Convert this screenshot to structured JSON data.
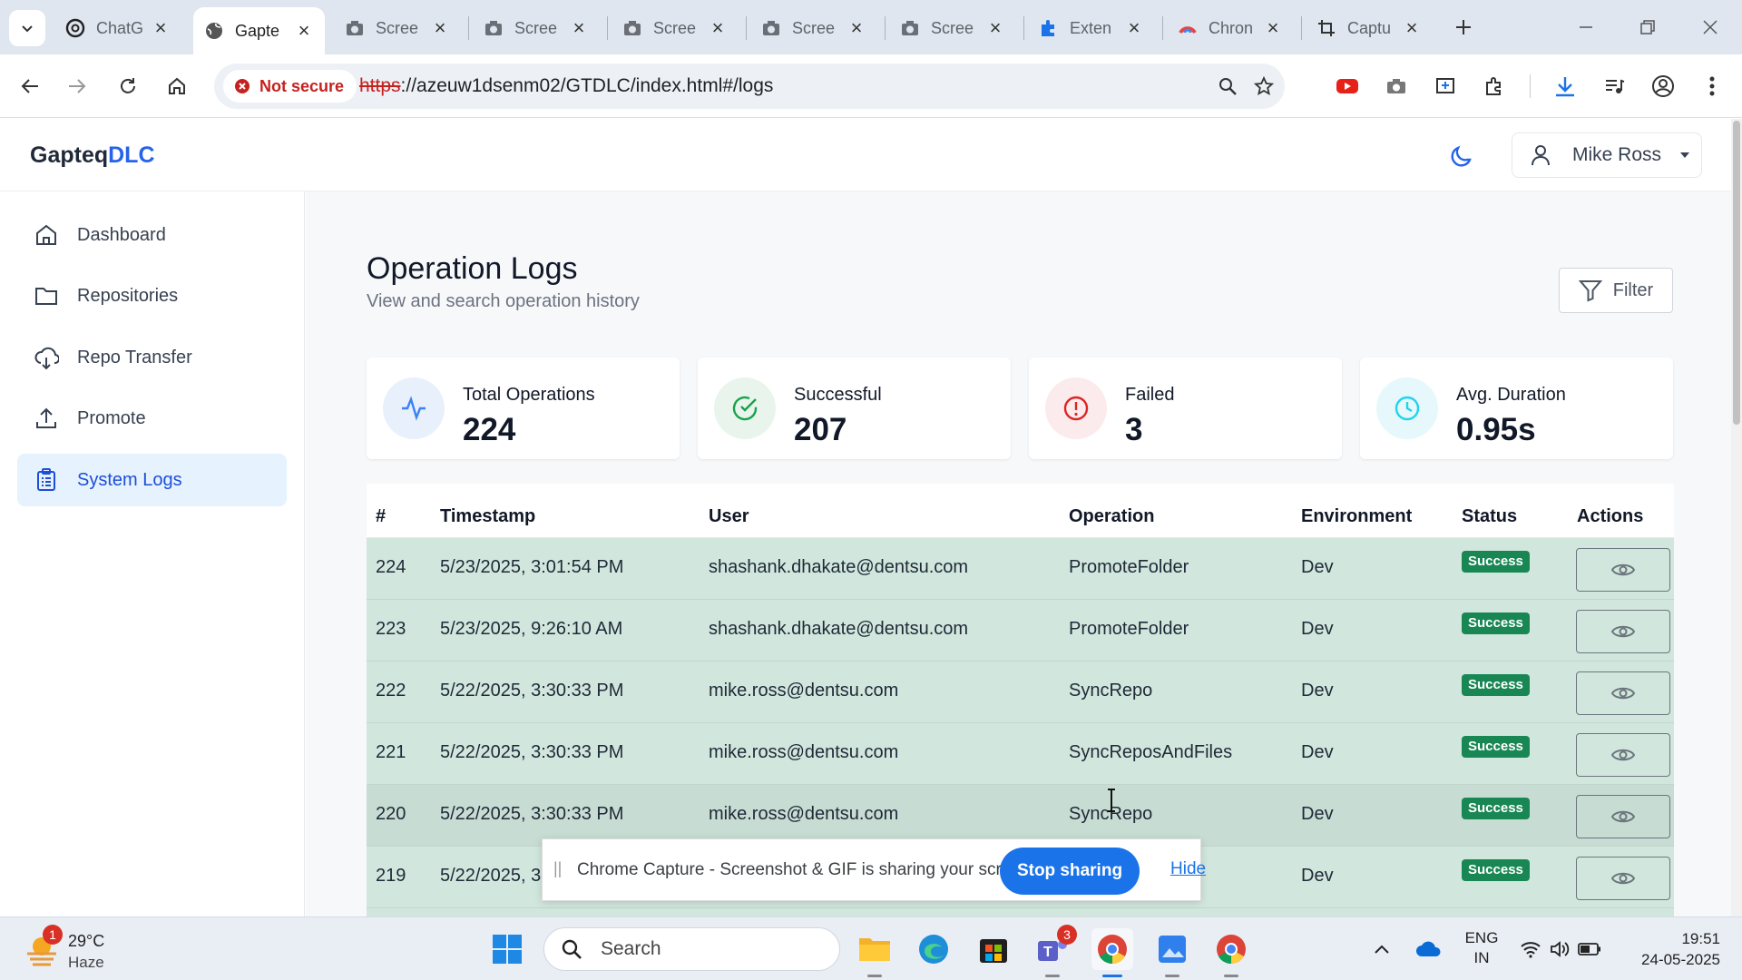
{
  "browser": {
    "tabs": [
      {
        "title": "ChatG",
        "icon": "openai-icon"
      },
      {
        "title": "Gapte",
        "icon": "globe-icon",
        "active": true
      },
      {
        "title": "Scree",
        "icon": "camera-icon"
      },
      {
        "title": "Scree",
        "icon": "camera-icon"
      },
      {
        "title": "Scree",
        "icon": "camera-icon"
      },
      {
        "title": "Scree",
        "icon": "camera-icon"
      },
      {
        "title": "Scree",
        "icon": "camera-icon"
      },
      {
        "title": "Exten",
        "icon": "puzzle-icon"
      },
      {
        "title": "Chron",
        "icon": "chrome-icon"
      },
      {
        "title": "Captu",
        "icon": "capture-icon"
      }
    ],
    "security_label": "Not secure",
    "url_scheme": "https",
    "url_rest": "://azeuw1dsenm02/GTDLC/index.html#/logs"
  },
  "app": {
    "brand_main": "Gapteq",
    "brand_accent": "DLC",
    "user_name": "Mike Ross"
  },
  "sidebar": {
    "items": [
      {
        "label": "Dashboard",
        "icon": "home-icon"
      },
      {
        "label": "Repositories",
        "icon": "folder-icon"
      },
      {
        "label": "Repo Transfer",
        "icon": "cloud-transfer-icon"
      },
      {
        "label": "Promote",
        "icon": "upload-icon"
      },
      {
        "label": "System Logs",
        "icon": "clipboard-icon",
        "active": true
      }
    ]
  },
  "page": {
    "title": "Operation Logs",
    "subtitle": "View and search operation history",
    "filter_label": "Filter"
  },
  "stats": [
    {
      "label": "Total Operations",
      "value": "224",
      "icon": "activity-icon",
      "color": "#3b82f6"
    },
    {
      "label": "Successful",
      "value": "207",
      "icon": "check-circle-icon",
      "color": "#16a34a"
    },
    {
      "label": "Failed",
      "value": "3",
      "icon": "alert-circle-icon",
      "color": "#dc2626"
    },
    {
      "label": "Avg. Duration",
      "value": "0.95s",
      "icon": "clock-icon",
      "color": "#22d3ee"
    }
  ],
  "table": {
    "headers": [
      "#",
      "Timestamp",
      "User",
      "Operation",
      "Environment",
      "Status",
      "Actions"
    ],
    "rows": [
      {
        "id": "224",
        "timestamp": "5/23/2025, 3:01:54 PM",
        "user": "shashank.dhakate@dentsu.com",
        "operation": "PromoteFolder",
        "env": "Dev",
        "status": "Success"
      },
      {
        "id": "223",
        "timestamp": "5/23/2025, 9:26:10 AM",
        "user": "shashank.dhakate@dentsu.com",
        "operation": "PromoteFolder",
        "env": "Dev",
        "status": "Success"
      },
      {
        "id": "222",
        "timestamp": "5/22/2025, 3:30:33 PM",
        "user": "mike.ross@dentsu.com",
        "operation": "SyncRepo",
        "env": "Dev",
        "status": "Success"
      },
      {
        "id": "221",
        "timestamp": "5/22/2025, 3:30:33 PM",
        "user": "mike.ross@dentsu.com",
        "operation": "SyncReposAndFiles",
        "env": "Dev",
        "status": "Success"
      },
      {
        "id": "220",
        "timestamp": "5/22/2025, 3:30:33 PM",
        "user": "mike.ross@dentsu.com",
        "operation": "SyncRepo",
        "env": "Dev",
        "status": "Success"
      },
      {
        "id": "219",
        "timestamp": "5/22/2025, 3",
        "user": "",
        "operation": "",
        "env": "Dev",
        "status": "Success"
      }
    ]
  },
  "share_bar": {
    "message": "Chrome Capture - Screenshot & GIF is sharing your screen.",
    "stop_label": "Stop sharing",
    "hide_label": "Hide"
  },
  "taskbar": {
    "weather_temp": "29°C",
    "weather_desc": "Haze",
    "weather_badge": "1",
    "search_placeholder": "Search",
    "teams_badge": "3",
    "lang_top": "ENG",
    "lang_bottom": "IN",
    "time": "19:51",
    "date": "24-05-2025"
  },
  "colors": {
    "accent": "#2563eb",
    "row_success": "#d1e7dd",
    "badge_success": "#198754",
    "sidebar_active": "#e6f2fd"
  }
}
